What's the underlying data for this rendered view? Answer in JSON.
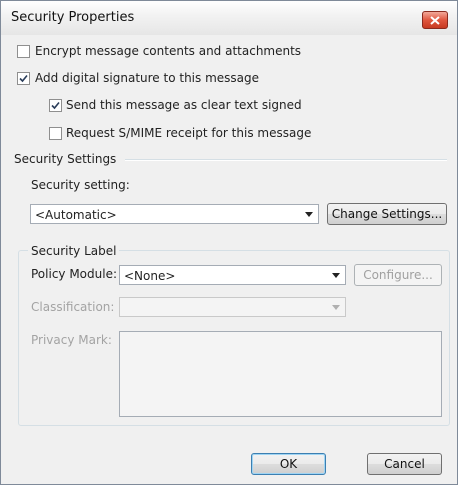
{
  "window": {
    "title": "Security Properties",
    "close_icon": "close-x-icon"
  },
  "options": {
    "encrypt": {
      "label": "Encrypt message contents and attachments",
      "checked": false
    },
    "sign": {
      "label": "Add digital signature to this message",
      "checked": true
    },
    "clear_text": {
      "label": "Send this message as clear text signed",
      "checked": true
    },
    "smime_receipt": {
      "label": "Request S/MIME receipt for this message",
      "checked": false
    }
  },
  "security_settings": {
    "section_title": "Security Settings",
    "setting_label": "Security setting:",
    "setting_value": "<Automatic>",
    "change_button": "Change Settings..."
  },
  "security_label": {
    "group_title": "Security Label",
    "policy_label": "Policy Module:",
    "policy_value": "<None>",
    "configure_button": "Configure...",
    "classification_label": "Classification:",
    "classification_value": "",
    "privacy_label": "Privacy Mark:",
    "privacy_value": ""
  },
  "footer": {
    "ok": "OK",
    "cancel": "Cancel"
  },
  "colors": {
    "close_red": "#c73a22",
    "default_button_border": "#3c7fb1"
  }
}
